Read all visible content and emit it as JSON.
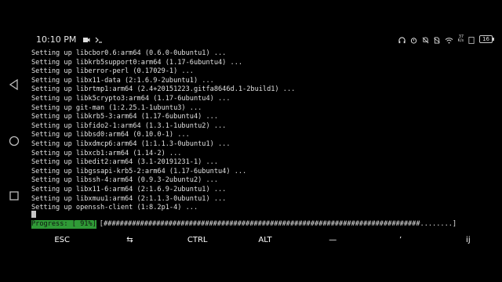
{
  "status": {
    "time": "10:10 PM",
    "net_speed_top": "37",
    "net_speed_bottom": "K/s",
    "battery": "16"
  },
  "terminal": {
    "lines": [
      "Setting up libcbor0.6:arm64 (0.6.0-0ubuntu1) ...",
      "Setting up libkrb5support0:arm64 (1.17-6ubuntu4) ...",
      "Setting up liberror-perl (0.17029-1) ...",
      "Setting up libx11-data (2:1.6.9-2ubuntu1) ...",
      "Setting up librtmp1:arm64 (2.4+20151223.gitfa8646d.1-2build1) ...",
      "Setting up libk5crypto3:arm64 (1.17-6ubuntu4) ...",
      "Setting up git-man (1:2.25.1-1ubuntu3) ...",
      "Setting up libkrb5-3:arm64 (1.17-6ubuntu4) ...",
      "Setting up libfido2-1:arm64 (1.3.1-1ubuntu2) ...",
      "Setting up libbsd0:arm64 (0.10.0-1) ...",
      "Setting up libxdmcp6:arm64 (1:1.1.3-0ubuntu1) ...",
      "Setting up libxcb1:arm64 (1.14-2) ...",
      "Setting up libedit2:arm64 (3.1-20191231-1) ...",
      "Setting up libgssapi-krb5-2:arm64 (1.17-6ubuntu4) ...",
      "Setting up libssh-4:arm64 (0.9.3-2ubuntu2) ...",
      "Setting up libx11-6:arm64 (2:1.6.9-2ubuntu1) ...",
      "Setting up libxmuu1:arm64 (2:1.1.3-0ubuntu1) ...",
      "Setting up openssh-client (1:8.2p1-4) ..."
    ],
    "progress_label": "Progress: [ 91%]",
    "progress_bar": "[##############################################################################........]"
  },
  "extra_keys": [
    "ESC",
    "⇆",
    "CTRL",
    "ALT",
    "—",
    "’",
    "ij"
  ],
  "colors": {
    "progress_green": "#2f9a36",
    "background": "#000000",
    "text": "#e0e0e0"
  }
}
